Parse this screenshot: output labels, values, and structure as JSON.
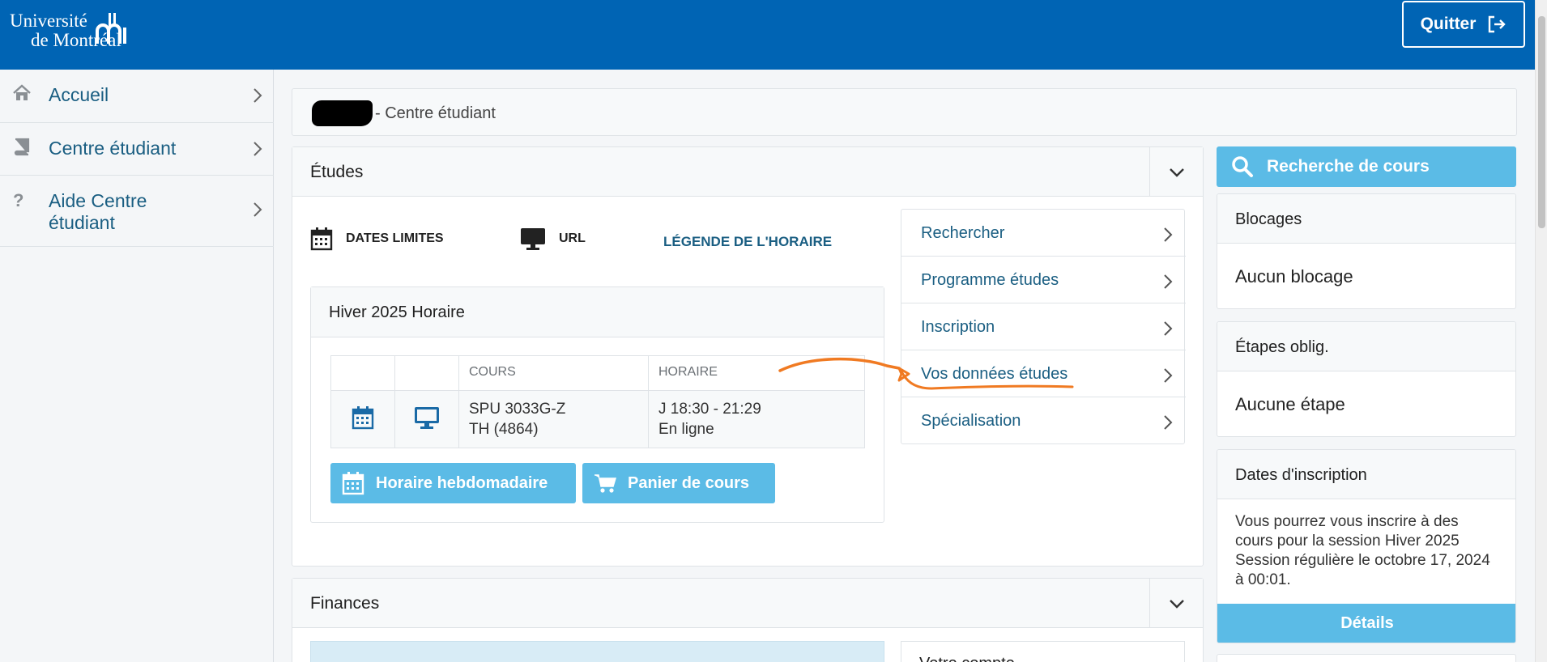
{
  "header": {
    "logo_line1": "Université",
    "logo_line2": "de Montréal",
    "quit_label": "Quitter",
    "bg_color": "#0064b4"
  },
  "sidebar": {
    "items": [
      {
        "label": "Accueil",
        "icon": "home-icon"
      },
      {
        "label": "Centre étudiant",
        "icon": "book-icon"
      },
      {
        "label": "Aide Centre étudiant",
        "icon": "question-icon"
      }
    ]
  },
  "breadcrumb": {
    "text": "- Centre étudiant"
  },
  "etudes": {
    "title": "Études",
    "quick_links": {
      "dates": "DATES LIMITES",
      "url": "URL",
      "legend": "LÉGENDE DE L'HORAIRE"
    },
    "schedule": {
      "title": "Hiver 2025 Horaire",
      "columns": [
        "",
        "",
        "COURS",
        "HORAIRE"
      ],
      "rows": [
        {
          "course_line1": "SPU 3033G-Z",
          "course_line2": "TH (4864)",
          "time_line1": "J 18:30 - 21:29",
          "time_line2": "En ligne"
        }
      ],
      "weekly_button": "Horaire hebdomadaire",
      "cart_button": "Panier de cours"
    },
    "menu": [
      "Rechercher",
      "Programme études",
      "Inscription",
      "Vos données études",
      "Spécialisation"
    ]
  },
  "finances": {
    "title": "Finances",
    "side_label": "Votre compte"
  },
  "right": {
    "search_button": "Recherche de cours",
    "blocages": {
      "title": "Blocages",
      "body": "Aucun blocage"
    },
    "etapes": {
      "title": "Étapes oblig.",
      "body": "Aucune étape"
    },
    "dates_inscription": {
      "title": "Dates d'inscription",
      "body": "Vous pourrez vous inscrire à des cours pour la session Hiver 2025 Session régulière le octobre 17, 2024 à 00:01.",
      "details_button": "Détails"
    }
  },
  "colors": {
    "accent_blue": "#5bbbe6",
    "link_blue": "#1a5e82",
    "annotation_orange": "#f07a22"
  }
}
